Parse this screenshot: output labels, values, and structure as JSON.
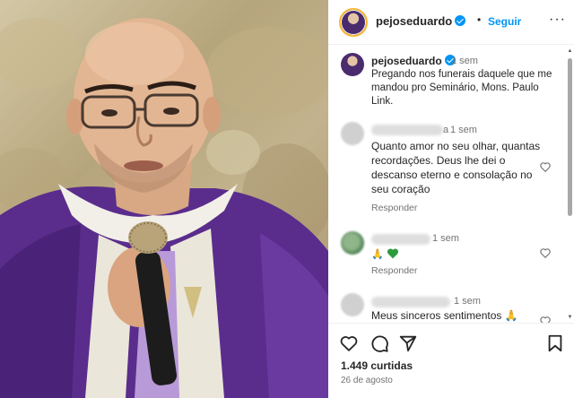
{
  "post": {
    "author": "pejoseduardo",
    "separator": "•",
    "follow_label": "Seguir",
    "more_label": "···",
    "caption_author": "pejoseduardo",
    "caption_time": "1 sem",
    "caption_text": "Pregando nos funerais daquele que me mandou pro Seminário, Mons. Paulo Link.",
    "likes": "1.449 curtidas",
    "date": "26 de agosto"
  },
  "comments": [
    {
      "username_visible": "a",
      "time": "1 sem",
      "text": "Quanto amor no seu olhar, quantas recordações. Deus lhe dei o descanso eterno e consolação no seu coração",
      "reply_label": "Responder"
    },
    {
      "time": "1 sem",
      "emoji_text": "🙏",
      "reply_label": "Responder"
    },
    {
      "time": "1 sem",
      "text": "Meus sinceros sentimentos 🙏"
    }
  ],
  "icons": {
    "like": "heart-icon",
    "comment": "comment-icon",
    "share": "share-icon",
    "save": "bookmark-icon",
    "verified": "verified-badge-icon"
  },
  "colors": {
    "accent": "#0095f6",
    "secondary_text": "#737373",
    "vestment_purple": "#5a2d8c",
    "green_heart": "#2e9a3e"
  }
}
